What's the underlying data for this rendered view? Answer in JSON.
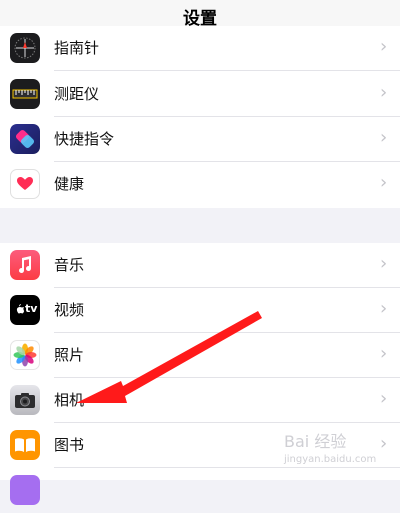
{
  "header": {
    "title": "设置"
  },
  "group1": {
    "items": [
      {
        "label": "指南针",
        "icon": "compass-icon"
      },
      {
        "label": "测距仪",
        "icon": "measure-icon"
      },
      {
        "label": "快捷指令",
        "icon": "shortcuts-icon"
      },
      {
        "label": "健康",
        "icon": "health-icon"
      }
    ]
  },
  "group2": {
    "items": [
      {
        "label": "音乐",
        "icon": "music-icon"
      },
      {
        "label": "视频",
        "icon": "apple-tv-icon",
        "icon_text": "tv"
      },
      {
        "label": "照片",
        "icon": "photos-icon"
      },
      {
        "label": "相机",
        "icon": "camera-icon"
      },
      {
        "label": "图书",
        "icon": "books-icon"
      }
    ]
  },
  "chevron": "›",
  "watermark": {
    "text": "Bai 经验",
    "sub": "jingyan.baidu.com"
  },
  "colors": {
    "annotation_arrow": "#ff1a1a",
    "health": "#ff2d55",
    "music": "#fc3c44",
    "books": "#ff9500"
  }
}
